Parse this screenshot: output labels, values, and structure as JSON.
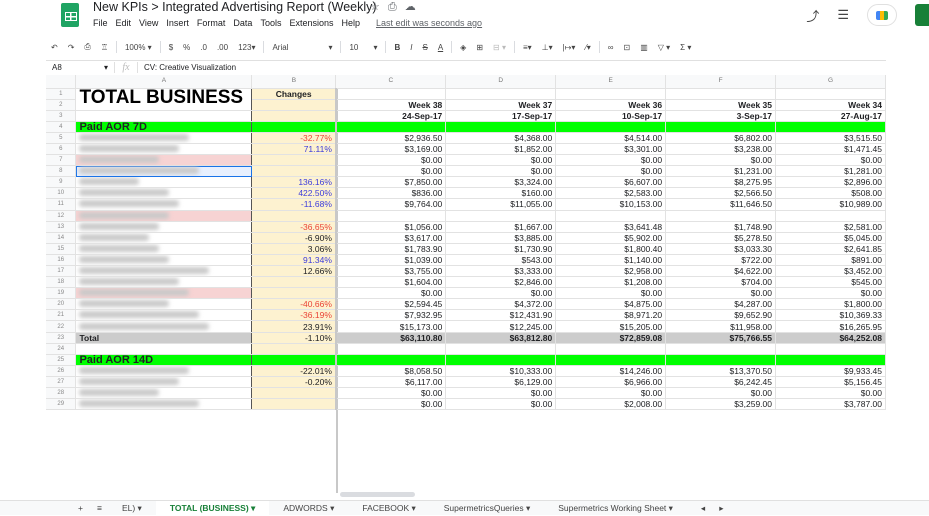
{
  "app": {
    "doc_title": "New KPIs > Integrated Advertising Report (Weekly)",
    "title_icons": [
      "star-icon",
      "move-to-folder-icon",
      "cloud-status-icon"
    ],
    "menu": [
      "File",
      "Edit",
      "View",
      "Insert",
      "Format",
      "Data",
      "Tools",
      "Extensions",
      "Help"
    ],
    "last_edit": "Last edit was seconds ago",
    "top_right": [
      "activity-trend-icon",
      "comments-icon",
      "meet-icon",
      "share-button"
    ]
  },
  "toolbar": {
    "zoom": "100%",
    "currency": "$",
    "percent": "%",
    "dec_decrease": ".0",
    "dec_increase": ".00",
    "more_formats": "123",
    "font": "Arial",
    "font_size": "10",
    "bold": "B",
    "italic": "I",
    "strike": "S",
    "text_color": "A"
  },
  "formula_bar": {
    "cell_ref": "A8",
    "fx": "fx",
    "value": "CV: Creative Visualization"
  },
  "columns": [
    "A",
    "B",
    "C",
    "D",
    "E",
    "F",
    "G"
  ],
  "sheet": {
    "title": "TOTAL BUSINESS",
    "changes_header": "Changes",
    "weeks": [
      "Week 38",
      "Week 37",
      "Week 36",
      "Week 35",
      "Week 34"
    ],
    "dates": [
      "24-Sep-17",
      "17-Sep-17",
      "10-Sep-17",
      "3-Sep-17",
      "27-Aug-17"
    ],
    "section1": "Paid AOR 7D",
    "section2": "Paid AOR 14D",
    "total_label": "Total",
    "rows": [
      {
        "n": "5",
        "change": "-32.77%",
        "tone": "neg",
        "vals": [
          "$2,936.50",
          "$4,368.00",
          "$4,514.00",
          "$6,802.00",
          "$3,515.50"
        ]
      },
      {
        "n": "6",
        "change": "71.11%",
        "tone": "pos",
        "vals": [
          "$3,169.00",
          "$1,852.00",
          "$3,301.00",
          "$3,238.00",
          "$1,471.45"
        ]
      },
      {
        "n": "7",
        "change": "",
        "tone": "",
        "pink": true,
        "vals": [
          "$0.00",
          "$0.00",
          "$0.00",
          "$0.00",
          "$0.00"
        ]
      },
      {
        "n": "8",
        "change": "",
        "tone": "",
        "selected": true,
        "vals": [
          "$0.00",
          "$0.00",
          "$0.00",
          "$1,231.00",
          "$1,281.00"
        ]
      },
      {
        "n": "9",
        "change": "136.16%",
        "tone": "pos",
        "vals": [
          "$7,850.00",
          "$3,324.00",
          "$6,607.00",
          "$8,275.95",
          "$2,896.00"
        ]
      },
      {
        "n": "10",
        "change": "422.50%",
        "tone": "pos",
        "vals": [
          "$836.00",
          "$160.00",
          "$2,583.00",
          "$2,566.50",
          "$508.00"
        ]
      },
      {
        "n": "11",
        "change": "-11.68%",
        "tone": "pos",
        "vals": [
          "$9,764.00",
          "$11,055.00",
          "$10,153.00",
          "$11,646.50",
          "$10,989.00"
        ]
      },
      {
        "n": "12",
        "change": "",
        "tone": "",
        "pink": true,
        "vals": [
          "",
          "",
          "",
          "",
          ""
        ]
      },
      {
        "n": "13",
        "change": "-36.65%",
        "tone": "neg",
        "vals": [
          "$1,056.00",
          "$1,667.00",
          "$3,641.48",
          "$1,748.90",
          "$2,581.00"
        ]
      },
      {
        "n": "14",
        "change": "-6.90%",
        "tone": "",
        "vals": [
          "$3,617.00",
          "$3,885.00",
          "$5,902.00",
          "$5,278.50",
          "$5,045.00"
        ]
      },
      {
        "n": "15",
        "change": "3.06%",
        "tone": "",
        "vals": [
          "$1,783.90",
          "$1,730.90",
          "$1,800.40",
          "$3,033.30",
          "$2,641.85"
        ]
      },
      {
        "n": "16",
        "change": "91.34%",
        "tone": "pos",
        "vals": [
          "$1,039.00",
          "$543.00",
          "$1,140.00",
          "$722.00",
          "$891.00"
        ]
      },
      {
        "n": "17",
        "change": "12.66%",
        "tone": "",
        "vals": [
          "$3,755.00",
          "$3,333.00",
          "$2,958.00",
          "$4,622.00",
          "$3,452.00"
        ]
      },
      {
        "n": "18",
        "change": "",
        "tone": "",
        "vals": [
          "$1,604.00",
          "$2,846.00",
          "$1,208.00",
          "$704.00",
          "$545.00"
        ]
      },
      {
        "n": "19",
        "change": "",
        "tone": "",
        "pink": true,
        "vals": [
          "$0.00",
          "$0.00",
          "$0.00",
          "$0.00",
          "$0.00"
        ]
      },
      {
        "n": "20",
        "change": "-40.66%",
        "tone": "neg",
        "vals": [
          "$2,594.45",
          "$4,372.00",
          "$4,875.00",
          "$4,287.00",
          "$1,800.00"
        ]
      },
      {
        "n": "21",
        "change": "-36.19%",
        "tone": "neg",
        "vals": [
          "$7,932.95",
          "$12,431.90",
          "$8,971.20",
          "$9,652.90",
          "$10,369.33"
        ]
      },
      {
        "n": "22",
        "change": "23.91%",
        "tone": "",
        "vals": [
          "$15,173.00",
          "$12,245.00",
          "$15,205.00",
          "$11,958.00",
          "$16,265.95"
        ]
      }
    ],
    "total": {
      "n": "23",
      "change": "-1.10%",
      "vals": [
        "$63,110.80",
        "$63,812.80",
        "$72,859.08",
        "$75,766.55",
        "$64,252.08"
      ]
    },
    "rows2": [
      {
        "n": "26",
        "change": "-22.01%",
        "vals": [
          "$8,058.50",
          "$10,333.00",
          "$14,246.00",
          "$13,370.50",
          "$9,933.45"
        ]
      },
      {
        "n": "27",
        "change": "-0.20%",
        "vals": [
          "$6,117.00",
          "$6,129.00",
          "$6,966.00",
          "$6,242.45",
          "$5,156.45"
        ]
      },
      {
        "n": "28",
        "change": "",
        "vals": [
          "$0.00",
          "$0.00",
          "$0.00",
          "$0.00",
          "$0.00"
        ]
      },
      {
        "n": "29",
        "change": "",
        "vals": [
          "$0.00",
          "$0.00",
          "$2,008.00",
          "$3,259.00",
          "$3,787.00"
        ]
      }
    ]
  },
  "tabs": {
    "add": "+",
    "all_sheets": "≡",
    "items": [
      "EL)",
      "TOTAL (BUSINESS)",
      "ADWORDS",
      "FACEBOOK",
      "SupermetricsQueries",
      "Supermetrics Working Sheet"
    ],
    "active_index": 1
  }
}
